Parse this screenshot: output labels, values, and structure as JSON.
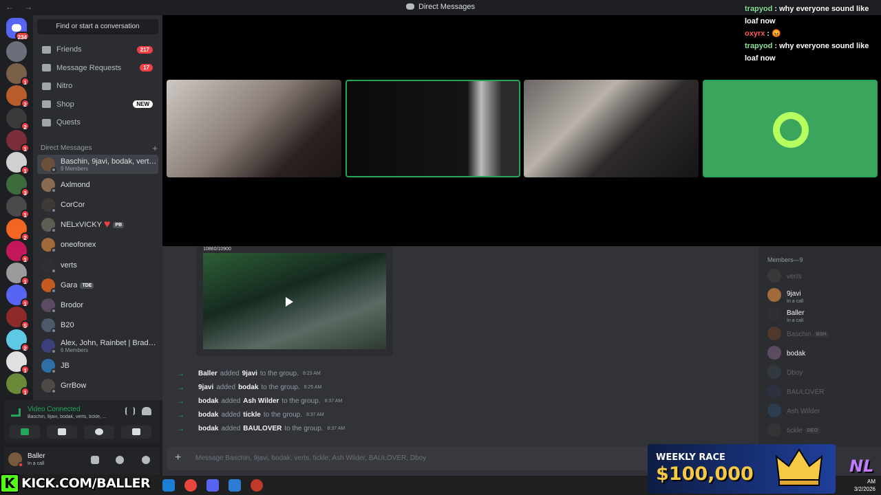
{
  "window": {
    "title": "Direct Messages",
    "nav": "← →"
  },
  "stream_chat": [
    {
      "user": "trapyod",
      "sep": " : ",
      "msg": "why everyone sound like loaf now"
    },
    {
      "user": "oxyrx",
      "sep": " : ",
      "msg": "😡"
    },
    {
      "user": "trapyod",
      "sep": " : ",
      "msg": "why everyone sound like loaf now"
    }
  ],
  "colors": {
    "accent": "#5865f2",
    "green": "#23a55a",
    "red": "#f23f43",
    "bg_main": "#313338",
    "bg_sidebar": "#2b2d31"
  },
  "rail": {
    "home_badge": "234",
    "new_label": "NEW",
    "server_badges": [
      "",
      "1",
      "2",
      "2",
      "1",
      "1",
      "3",
      "1",
      "2",
      "1",
      "1",
      "1",
      "5",
      "2",
      "1",
      "1"
    ]
  },
  "sidebar": {
    "search_label": "Find or start a conversation",
    "nav": [
      {
        "label": "Friends",
        "badge": "217",
        "icon": "friends-icon"
      },
      {
        "label": "Message Requests",
        "badge": "17",
        "icon": "mail-icon"
      },
      {
        "label": "Nitro",
        "badge": "",
        "icon": "nitro-icon"
      },
      {
        "label": "Shop",
        "badge": "NEW",
        "icon": "shop-icon"
      },
      {
        "label": "Quests",
        "badge": "",
        "icon": "quests-icon"
      }
    ],
    "dm_header": "Direct Messages",
    "dms": [
      {
        "name": "Baschin, 9javi, bodak, verts, ...",
        "sub": "9 Members",
        "selected": true
      },
      {
        "name": "Axlmond",
        "sub": ""
      },
      {
        "name": "CorCor",
        "sub": ""
      },
      {
        "name": "NELxVICKY",
        "sub": "",
        "tag": "PB",
        "heart": "♥"
      },
      {
        "name": "oneofonex",
        "sub": ""
      },
      {
        "name": "verts",
        "sub": ""
      },
      {
        "name": "Gara",
        "sub": "",
        "tag": "TDE"
      },
      {
        "name": "Brodor",
        "sub": ""
      },
      {
        "name": "B20",
        "sub": ""
      },
      {
        "name": "Alex, John, Rainbet | Brad, R...",
        "sub": "6 Members"
      },
      {
        "name": "JB",
        "sub": ""
      },
      {
        "name": "GrrBow",
        "sub": ""
      }
    ]
  },
  "voice": {
    "title": "Video Connected",
    "subtitle": "Baschin, 9javi, bodak, verts, tickle, ..."
  },
  "user": {
    "name": "Baller",
    "status": "In a call"
  },
  "embed": {
    "counter": "10860/10900"
  },
  "system_messages": [
    {
      "actor": "Baller",
      "verb": "added",
      "target": "9javi",
      "rest": "to the group.",
      "time": "8:23 AM"
    },
    {
      "actor": "9javi",
      "verb": "added",
      "target": "bodak",
      "rest": "to the group.",
      "time": "8:25 AM"
    },
    {
      "actor": "bodak",
      "verb": "added",
      "target": "Ash Wilder",
      "rest": "to the group.",
      "time": "8:37 AM"
    },
    {
      "actor": "bodak",
      "verb": "added",
      "target": "tickle",
      "rest": "to the group.",
      "time": "8:37 AM"
    },
    {
      "actor": "bodak",
      "verb": "added",
      "target": "BAULOVER",
      "rest": "to the group.",
      "time": "8:37 AM"
    }
  ],
  "composer": {
    "placeholder": "Message Baschin, 9javi, bodak, verts, tickle, Ash Wilder, BAULOVER, Dboy"
  },
  "members": {
    "header": "Members—9",
    "list": [
      {
        "name": "verts",
        "sub": "",
        "dim": true,
        "tag": ""
      },
      {
        "name": "9javi",
        "sub": "In a call",
        "dim": false,
        "tag": ""
      },
      {
        "name": "Baller",
        "sub": "In a call",
        "dim": false,
        "tag": ""
      },
      {
        "name": "Baschin",
        "sub": "",
        "dim": true,
        "tag": "BSH"
      },
      {
        "name": "bodak",
        "sub": "",
        "dim": false,
        "tag": ""
      },
      {
        "name": "Dboy",
        "sub": "",
        "dim": true,
        "tag": ""
      },
      {
        "name": "BAULOVER",
        "sub": "",
        "dim": true,
        "tag": ""
      },
      {
        "name": "Ash Wilder",
        "sub": "",
        "dim": true,
        "tag": ""
      },
      {
        "name": "tickle",
        "sub": "",
        "dim": true,
        "tag": "DEO"
      }
    ]
  },
  "overlays": {
    "kick_k": "K",
    "kick": "KICK.COM/BALLER",
    "race_title": "WEEKLY RACE",
    "race_amount": "$100,000",
    "brand": "NL"
  },
  "taskbar": {
    "time": "AM",
    "date": "3/2/2026"
  }
}
